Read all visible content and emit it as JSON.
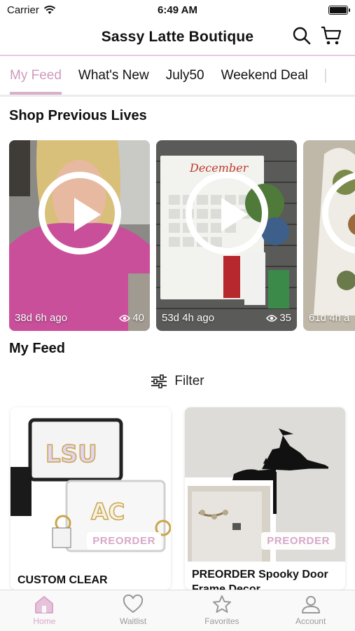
{
  "status_bar": {
    "carrier": "Carrier",
    "time": "6:49 AM"
  },
  "header": {
    "title": "Sassy Latte Boutique",
    "icons": [
      "search-icon",
      "cart-icon"
    ]
  },
  "tabs": [
    {
      "label": "My Feed",
      "active": true
    },
    {
      "label": "What's New"
    },
    {
      "label": "July50"
    },
    {
      "label": "Weekend Deal"
    }
  ],
  "lives_section": {
    "title": "Shop Previous Lives",
    "items": [
      {
        "age": "38d 6h ago",
        "views": "40"
      },
      {
        "age": "53d 4h ago",
        "views": "35",
        "image_text": "December"
      },
      {
        "age": "61d 4h a"
      }
    ]
  },
  "feed_section": {
    "title": "My Feed",
    "filter_label": "Filter"
  },
  "products": [
    {
      "badge": "PREORDER",
      "title": "CUSTOM CLEAR",
      "image_text_1": "LSU",
      "image_text_2": "AC"
    },
    {
      "badge": "PREORDER",
      "title": "PREORDER Spooky Door Frame Decor"
    }
  ],
  "bottom_nav": [
    {
      "label": "Home",
      "icon": "home-icon",
      "active": true
    },
    {
      "label": "Waitlist",
      "icon": "heart-icon"
    },
    {
      "label": "Favorites",
      "icon": "star-icon"
    },
    {
      "label": "Account",
      "icon": "account-icon"
    }
  ],
  "colors": {
    "accent": "#d7a8c9",
    "tab_underline": "#d9b0cc",
    "divider": "#e8c9dc"
  }
}
